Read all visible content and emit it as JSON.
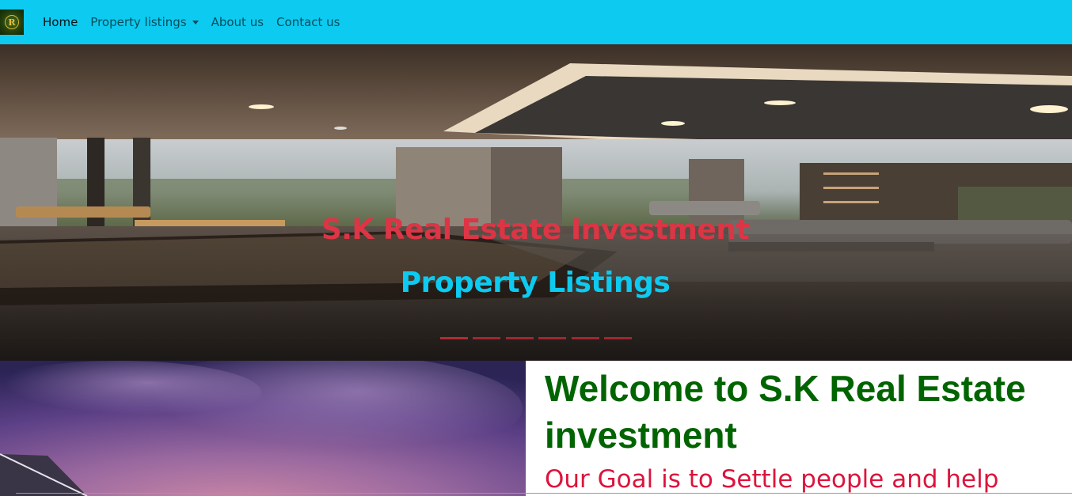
{
  "navbar": {
    "logo_letter": "R",
    "links": [
      {
        "label": "Home",
        "active": true
      },
      {
        "label": "Property listings",
        "dropdown": true
      },
      {
        "label": "About us"
      },
      {
        "label": "Contact us"
      }
    ]
  },
  "hero": {
    "title": "S.K Real Estate Investment",
    "subtitle": "Property Listings",
    "slide_count": 6,
    "active_slide": 0
  },
  "intro": {
    "heading": "Welcome to S.K Real Estate investment",
    "goal": "Our Goal is to Settle people and help"
  },
  "colors": {
    "navbar_bg": "#0dcaf0",
    "title_red": "#dc3545",
    "subtitle_cyan": "#0dcaf0",
    "heading_green": "#006400",
    "goal_crimson": "#dc143c"
  }
}
